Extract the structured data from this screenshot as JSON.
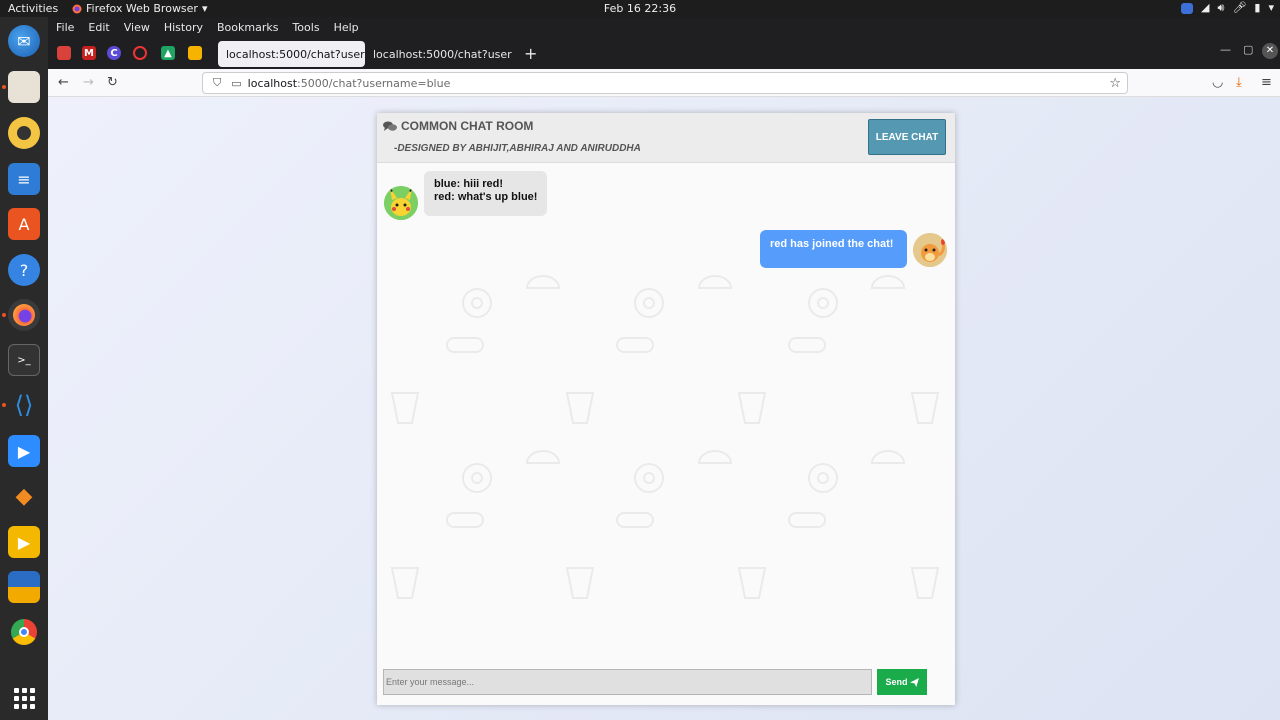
{
  "system": {
    "activities": "Activities",
    "app_name": "Firefox Web Browser",
    "clock": "Feb 16  22:36"
  },
  "browser": {
    "menu": [
      "File",
      "Edit",
      "View",
      "History",
      "Bookmarks",
      "Tools",
      "Help"
    ],
    "tabs": [
      {
        "label": "localhost:5000/chat?usernar",
        "active": true
      },
      {
        "label": "localhost:5000/chat?usernar",
        "active": false
      }
    ],
    "url_host": "localhost",
    "url_rest": ":5000/chat?username=blue"
  },
  "chat": {
    "title": "COMMON CHAT ROOM",
    "credits": "-DESIGNED BY ABHIJIT,ABHIRAJ AND ANIRUDDHA",
    "leave_label": "LEAVE CHAT",
    "messages": [
      {
        "side": "left",
        "lines": [
          "blue: hiii red!",
          "red: what's up blue!"
        ]
      },
      {
        "side": "right",
        "text": "red has joined the chat!"
      }
    ],
    "input_placeholder": "Enter your message...",
    "send_label": "Send"
  },
  "colors": {
    "leave_button": "#5598b2",
    "send_button": "#1aab4b",
    "outgoing_bubble": "#559cfb",
    "incoming_bubble": "#e6e6e6"
  }
}
